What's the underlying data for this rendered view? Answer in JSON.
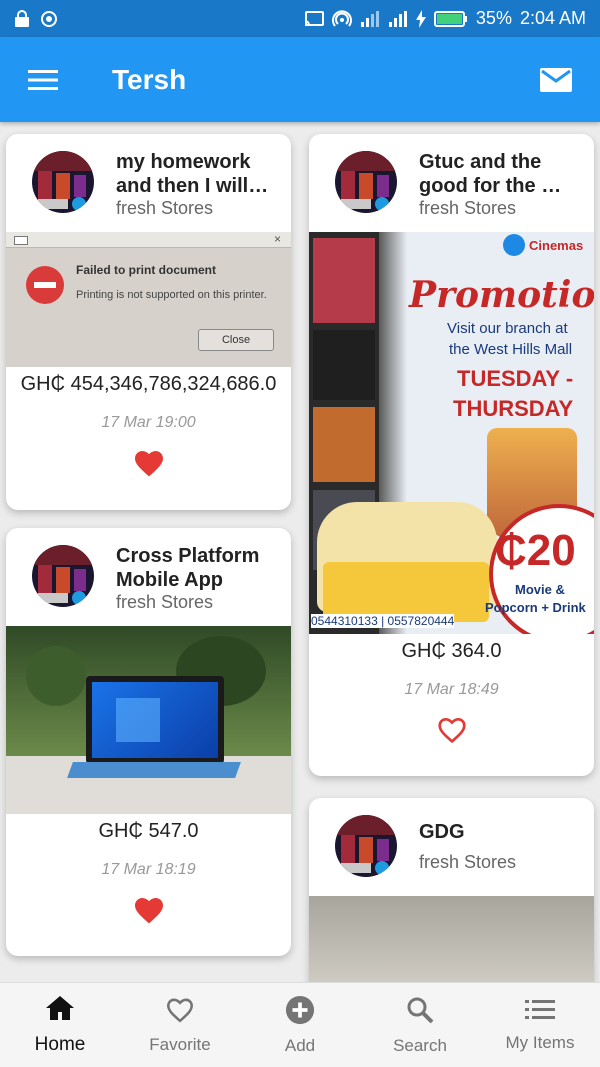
{
  "status_bar": {
    "battery": "35%",
    "time": "2:04 AM"
  },
  "app_bar": {
    "title": "Tersh"
  },
  "posts": [
    {
      "title": "my homework and then I will…",
      "store": "fresh Stores",
      "price": "GH₵ 454,346,786,324,686.0",
      "date": "17 Mar 19:00",
      "favorited": true,
      "dialog": {
        "title": "Failed to print document",
        "message": "Printing is not supported on this printer.",
        "button": "Close"
      }
    },
    {
      "title": "Gtuc and the good for the …",
      "store": "fresh Stores",
      "price": "GH₵ 364.0",
      "date": "17 Mar 18:49",
      "favorited": false,
      "promo": {
        "brand": "Cinemas",
        "headline": "Promotion",
        "line1": "Visit our branch at",
        "line2": "the West Hills Mall",
        "days": "TUESDAY -",
        "days2": "THURSDAY",
        "amount": "₵20",
        "offer1": "Movie &",
        "offer2": "Popcorn + Drink",
        "phones": "0544310133 | 0557820444"
      }
    },
    {
      "title": "Cross Platform Mobile App",
      "store": "fresh Stores",
      "price": "GH₵ 547.0",
      "date": "17 Mar 18:19",
      "favorited": true
    },
    {
      "title": "GDG",
      "store": "fresh Stores"
    }
  ],
  "bottom_nav": [
    {
      "label": "Home",
      "icon": "home-icon",
      "active": true
    },
    {
      "label": "Favorite",
      "icon": "heart-outline-icon",
      "active": false
    },
    {
      "label": "Add",
      "icon": "add-circle-icon",
      "active": false
    },
    {
      "label": "Search",
      "icon": "search-icon",
      "active": false
    },
    {
      "label": "My Items",
      "icon": "list-icon",
      "active": false
    }
  ],
  "colors": {
    "status_bar": "#1a78c8",
    "app_bar": "#2196f3",
    "heart": "#e53935"
  }
}
